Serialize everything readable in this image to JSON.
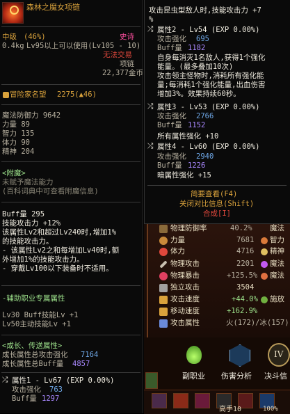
{
  "item": {
    "name": "森林之魔女项链",
    "grade": "中级",
    "grade_pct": "(46%)",
    "rarity": "史诗",
    "weight": "0.4kg",
    "level_req": "Lv95以上可以使用(Lv105 - 10)",
    "trade": "无法交易",
    "type": "项链",
    "price": "22,377金币",
    "adventure_label": "冒险家名望",
    "adventure_value": "2275(▲46)",
    "magic_def": "魔法防御力 9642",
    "stats": [
      "力量 89",
      "智力 135",
      "体力 90",
      "精神 204"
    ],
    "enchant_title": "<附魔>",
    "enchant_lines": [
      "未赋予魔法能力",
      "(百科词典中可查看附魔信息)"
    ],
    "buff_lines": [
      "Buff量 295",
      "技能攻击力 +12%",
      "该属性Lv2和超过Lv240时,增加1%",
      "的技能攻击力。",
      "- 该属性Lv2之和每增加Lv40时,额",
      "外增加1%的技能攻击力。",
      "- 穿戴Lv100以下装备时不适用。"
    ],
    "aux_title": "-辅助职业专属属性",
    "aux_lines": [
      "Lv30 Buff技能Lv +1",
      "Lv50主动技能Lv +1"
    ],
    "growth_title": "<成长、传送属性>",
    "growth_total_atk_label": "成长属性总攻击强化",
    "growth_total_atk": "7164",
    "growth_total_buff_label": "成长属性总Buff量",
    "growth_total_buff": "4857",
    "attr1_title": "属性1 - Lv67 (EXP 0.00%)",
    "attr1_atk_label": "攻击强化",
    "attr1_atk": "763",
    "attr1_buff_label": "Buff量",
    "attr1_buff": "1297"
  },
  "right": {
    "top_lines": [
      "攻击昆虫型敌人时,技能攻击力 +7",
      "%"
    ],
    "attr2_title": "属性2 - Lv54 (EXP 0.00%)",
    "attr2_atk_label": "攻击强化",
    "attr2_atk": "695",
    "attr2_buff_label": "Buff量",
    "attr2_buff": "1182",
    "attr2_desc": [
      "自身每消灭1名敌人,获得1个强化",
      "能量。(最多叠加10次)",
      "攻击领主怪物时,消耗所有强化能",
      "量;每消耗1个强化能量,出血伤害",
      "增加3%。效果持续60秒。"
    ],
    "attr3_title": "属性3 - Lv53 (EXP 0.00%)",
    "attr3_atk_label": "攻击强化",
    "attr3_atk": "2766",
    "attr3_buff_label": "Buff量",
    "attr3_buff": "1152",
    "attr3_extra": "所有属性强化 +10",
    "attr4_title": "属性4 - Lv60 (EXP 0.00%)",
    "attr4_atk_label": "攻击强化",
    "attr4_atk": "2940",
    "attr4_buff_label": "Buff量",
    "attr4_buff": "1226",
    "attr4_extra": "暗属性强化 +15",
    "link_detail": "简要查看(F4)",
    "link_compare": "关闭对比信息(Shift)",
    "link_combine": "合成[I]"
  },
  "char": {
    "rows": [
      {
        "label": "物理防御率",
        "value": "40.2%",
        "r_label": "魔法"
      },
      {
        "label": "力量",
        "value": "7681",
        "r_label": "智力"
      },
      {
        "label": "体力",
        "value": "4716",
        "r_label": "精神"
      },
      {
        "label": "物理攻击",
        "value": "2201",
        "r_label": "魔法"
      },
      {
        "label": "物理暴击",
        "value": "+125.5%",
        "r_label": "魔法"
      },
      {
        "label": "独立攻击",
        "value": "3504",
        "r_label": ""
      },
      {
        "label": "攻击速度",
        "value": "+44.0%",
        "r_label": "施放"
      },
      {
        "label": "移动速度",
        "value": "+162.9%",
        "r_label": ""
      },
      {
        "label": "攻击属性",
        "value": "火(172)/冰(157)",
        "r_label": ""
      }
    ],
    "btn_job": "副职业",
    "btn_damage": "伤害分析",
    "btn_duel": "决斗信",
    "badge": "IV",
    "hotbar_label": "高手10",
    "hotbar_pct": "100%"
  },
  "colors": {
    "gold": "#d9a23c",
    "green": "#9ee38c",
    "pink": "#ff4fa0",
    "red": "#e0483c"
  }
}
